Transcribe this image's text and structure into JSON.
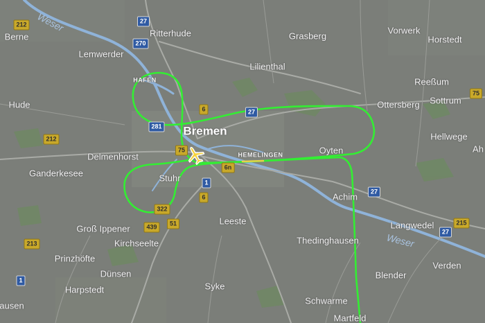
{
  "map": {
    "colors": {
      "background": "#7b7e79",
      "flight_track": "#33ee33",
      "water": "#8fb3d9",
      "road": "#a9aba6"
    },
    "places": [
      {
        "id": "bremen",
        "name": "Bremen",
        "kind": "city"
      },
      {
        "id": "berne",
        "name": "Berne",
        "kind": "town"
      },
      {
        "id": "lemwerder",
        "name": "Lemwerder",
        "kind": "town"
      },
      {
        "id": "ritterhude",
        "name": "Ritterhude",
        "kind": "town"
      },
      {
        "id": "grasberg",
        "name": "Grasberg",
        "kind": "town"
      },
      {
        "id": "vorwerk",
        "name": "Vorwerk",
        "kind": "town"
      },
      {
        "id": "horstedt",
        "name": "Horstedt",
        "kind": "town"
      },
      {
        "id": "lilienthal",
        "name": "Lilienthal",
        "kind": "town"
      },
      {
        "id": "reessum",
        "name": "Reeßum",
        "kind": "town"
      },
      {
        "id": "sottrum",
        "name": "Sottrum",
        "kind": "town"
      },
      {
        "id": "ottersberg",
        "name": "Ottersberg",
        "kind": "town"
      },
      {
        "id": "hude",
        "name": "Hude",
        "kind": "town"
      },
      {
        "id": "hellwege",
        "name": "Hellwege",
        "kind": "town"
      },
      {
        "id": "ah",
        "name": "Ah",
        "kind": "town"
      },
      {
        "id": "delmenhorst",
        "name": "Delmenhorst",
        "kind": "town"
      },
      {
        "id": "ganderkesee",
        "name": "Ganderkesee",
        "kind": "town"
      },
      {
        "id": "oyten",
        "name": "Oyten",
        "kind": "town"
      },
      {
        "id": "stuhr",
        "name": "Stuhr",
        "kind": "town"
      },
      {
        "id": "achim",
        "name": "Achim",
        "kind": "town"
      },
      {
        "id": "langwedel",
        "name": "Langwedel",
        "kind": "town"
      },
      {
        "id": "gross-ippener",
        "name": "Groß Ippener",
        "kind": "town"
      },
      {
        "id": "kirchseelte",
        "name": "Kirchseelte",
        "kind": "town"
      },
      {
        "id": "leeste",
        "name": "Leeste",
        "kind": "town"
      },
      {
        "id": "prinzhoefte",
        "name": "Prinzhöfte",
        "kind": "town"
      },
      {
        "id": "thedinghausen",
        "name": "Thedinghausen",
        "kind": "town"
      },
      {
        "id": "verden",
        "name": "Verden",
        "kind": "town"
      },
      {
        "id": "duensen",
        "name": "Dünsen",
        "kind": "town"
      },
      {
        "id": "blender",
        "name": "Blender",
        "kind": "town"
      },
      {
        "id": "harpstedt",
        "name": "Harpstedt",
        "kind": "town"
      },
      {
        "id": "syke",
        "name": "Syke",
        "kind": "town"
      },
      {
        "id": "schwarme",
        "name": "Schwarme",
        "kind": "town"
      },
      {
        "id": "ausen",
        "name": "ausen",
        "kind": "town"
      },
      {
        "id": "martfeld",
        "name": "Martfeld",
        "kind": "town"
      },
      {
        "id": "hafen",
        "name": "HAFEN",
        "kind": "district"
      },
      {
        "id": "hemelingen",
        "name": "HEMELINGEN",
        "kind": "district"
      }
    ],
    "water_labels": [
      {
        "id": "weser-north",
        "name": "Weser"
      },
      {
        "id": "weser-east",
        "name": "Weser"
      }
    ],
    "road_shields": [
      {
        "id": "r212a",
        "text": "212",
        "style": "yellow"
      },
      {
        "id": "a27n",
        "text": "27",
        "style": "blue"
      },
      {
        "id": "a270",
        "text": "270",
        "style": "blue"
      },
      {
        "id": "r6",
        "text": "6",
        "style": "yellow"
      },
      {
        "id": "a27m",
        "text": "27",
        "style": "blue"
      },
      {
        "id": "a281",
        "text": "281",
        "style": "blue"
      },
      {
        "id": "r212b",
        "text": "212",
        "style": "yellow"
      },
      {
        "id": "r75",
        "text": "75",
        "style": "yellow"
      },
      {
        "id": "r75b",
        "text": "75",
        "style": "yellow"
      },
      {
        "id": "r6n",
        "text": "6n",
        "style": "yellow"
      },
      {
        "id": "a1",
        "text": "1",
        "style": "blue"
      },
      {
        "id": "r6s",
        "text": "6",
        "style": "yellow"
      },
      {
        "id": "a27s",
        "text": "27",
        "style": "blue"
      },
      {
        "id": "r322",
        "text": "322",
        "style": "yellow"
      },
      {
        "id": "r439",
        "text": "439",
        "style": "yellow"
      },
      {
        "id": "r51",
        "text": "51",
        "style": "yellow"
      },
      {
        "id": "r213",
        "text": "213",
        "style": "yellow"
      },
      {
        "id": "a27e",
        "text": "27",
        "style": "blue"
      },
      {
        "id": "r215",
        "text": "215",
        "style": "yellow"
      },
      {
        "id": "a1s",
        "text": "1",
        "style": "blue"
      }
    ],
    "aircraft_icon": "airplane-icon"
  }
}
